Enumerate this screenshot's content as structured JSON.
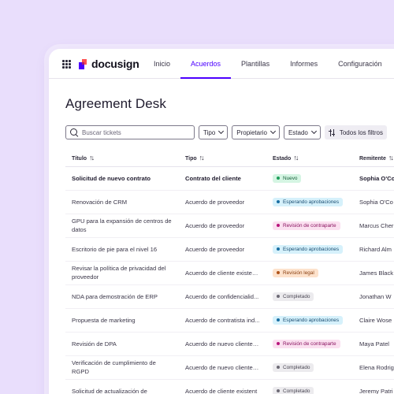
{
  "app": {
    "brand": "docusign"
  },
  "nav": [
    {
      "label": "Inicio",
      "active": false
    },
    {
      "label": "Acuerdos",
      "active": true
    },
    {
      "label": "Plantillas",
      "active": false
    },
    {
      "label": "Informes",
      "active": false
    },
    {
      "label": "Configuración",
      "active": false
    }
  ],
  "page": {
    "title": "Agreement Desk"
  },
  "toolbar": {
    "search_placeholder": "Buscar tickets",
    "filters": [
      "Tipo",
      "Propietario",
      "Estado"
    ],
    "all_filters_label": "Todos los filtros"
  },
  "table": {
    "headers": [
      "Título",
      "Tipo",
      "Estado",
      "Remitente"
    ],
    "rows": [
      {
        "title": "Solicitud de nuevo contrato",
        "type": "Contrato del cliente",
        "status": "Nuevo",
        "status_kind": "new",
        "sender": "Sophia O'Co",
        "bold": true
      },
      {
        "title": "Renovación de CRM",
        "type": "Acuerdo de proveedor",
        "status": "Esperando aprobaciones",
        "status_kind": "waiting",
        "sender": "Sophia O'Co",
        "bold": false
      },
      {
        "title": "GPU para la expansión de centros de datos",
        "type": "Acuerdo de proveedor",
        "status": "Revisión de contraparte",
        "status_kind": "counterparty",
        "sender": "Marcus Cher",
        "bold": false
      },
      {
        "title": "Escritorio de pie para el nivel 16",
        "type": "Acuerdo de proveedor",
        "status": "Esperando aprobaciones",
        "status_kind": "waiting",
        "sender": "Richard Alm",
        "bold": false
      },
      {
        "title": "Revisar la política de privacidad del proveedor",
        "type": "Acuerdo de cliente existent...",
        "status": "Revisión legal",
        "status_kind": "legal",
        "sender": "James Black",
        "bold": false
      },
      {
        "title": "NDA para demostración de ERP",
        "type": "Acuerdo de confidencialid...",
        "status": "Completado",
        "status_kind": "done",
        "sender": "Jonathan W",
        "bold": false
      },
      {
        "title": "Propuesta de marketing",
        "type": "Acuerdo de contratista ind...",
        "status": "Esperando aprobaciones",
        "status_kind": "waiting",
        "sender": "Claire Wose",
        "bold": false
      },
      {
        "title": "Revisión de DPA",
        "type": "Acuerdo de nuevo cliente (...",
        "status": "Revisión de contraparte",
        "status_kind": "counterparty",
        "sender": "Maya Patel",
        "bold": false
      },
      {
        "title": "Verificación de cumplimiento de RGPD",
        "type": "Acuerdo de nuevo cliente (...",
        "status": "Completado",
        "status_kind": "done",
        "sender": "Elena Rodrig",
        "bold": false
      },
      {
        "title": "Solicitud de actualización de",
        "type": "Acuerdo de cliente existent",
        "status": "Completado",
        "status_kind": "done",
        "sender": "Jeremy Patri",
        "bold": false
      }
    ]
  },
  "status_colors": {
    "new": {
      "bg": "#d5f5e3",
      "dot": "#1e9e5a",
      "fg": "#17603a"
    },
    "waiting": {
      "bg": "#d6f1fb",
      "dot": "#1a6fa3",
      "fg": "#1a4d72"
    },
    "counterparty": {
      "bg": "#fbe0f0",
      "dot": "#b8157c",
      "fg": "#8a1460"
    },
    "legal": {
      "bg": "#fde2cc",
      "dot": "#b0531a",
      "fg": "#8a3f10"
    },
    "done": {
      "bg": "#ecebee",
      "dot": "#6d6a75",
      "fg": "#4a4753"
    }
  },
  "accent": "#4c00ff"
}
